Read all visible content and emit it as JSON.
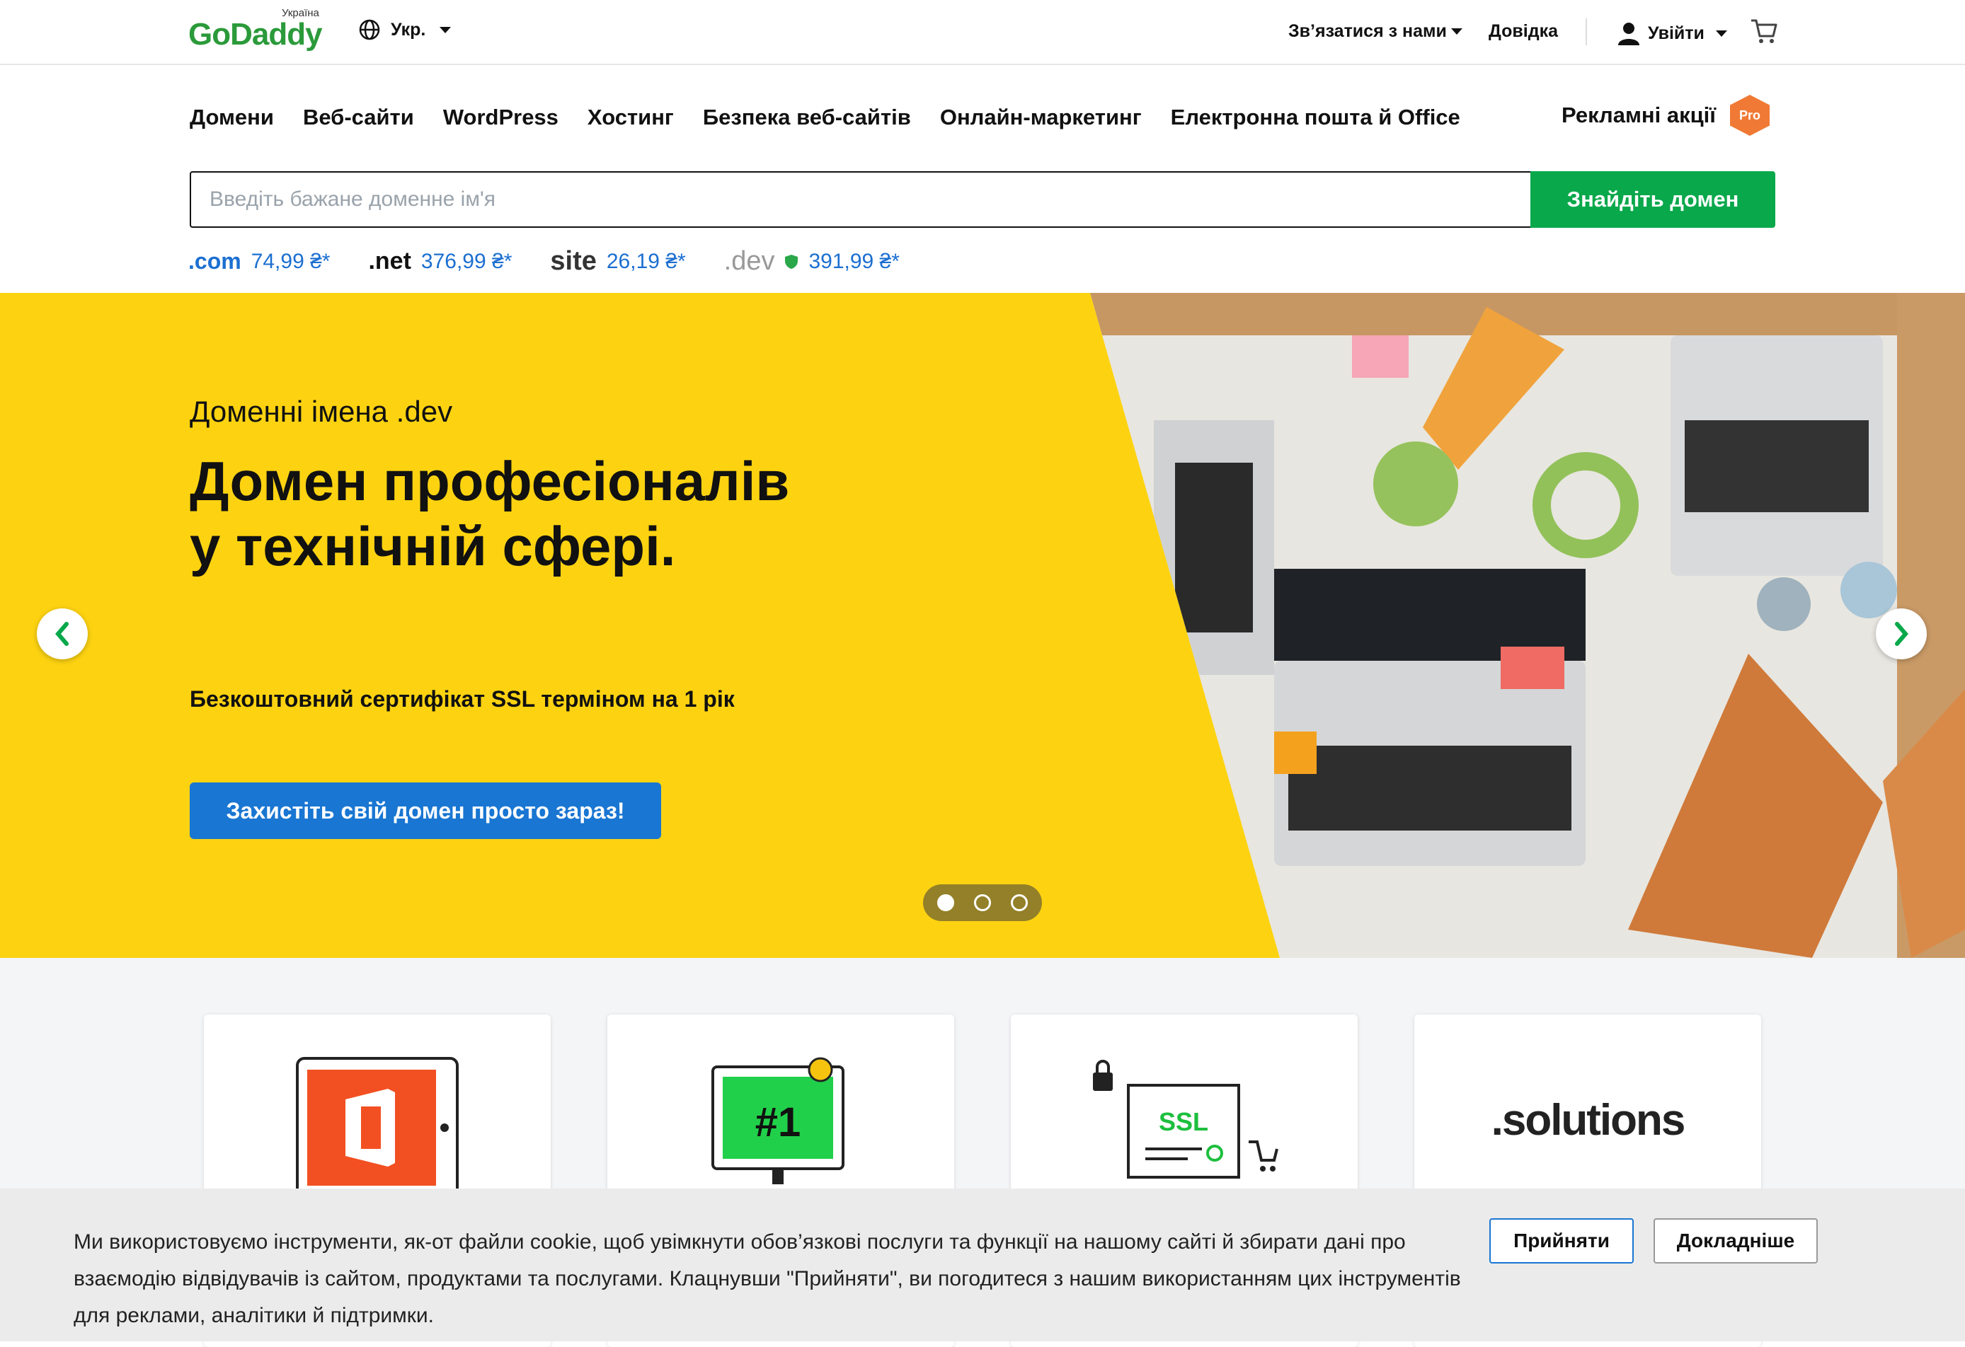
{
  "brand": {
    "name": "GoDaddy",
    "region": "Україна"
  },
  "topbar": {
    "language": "Укр.",
    "contact": "Зв’язатися з нами",
    "help": "Довідка",
    "login": "Увійти"
  },
  "nav": {
    "items": [
      "Домени",
      "Веб-сайти",
      "WordPress",
      "Хостинг",
      "Безпека веб-сайтів",
      "Онлайн-маркетинг",
      "Електронна пошта й Office"
    ],
    "promo": "Рекламні акції",
    "pro_badge": "Pro"
  },
  "search": {
    "placeholder": "Введіть бажане доменне ім'я",
    "button": "Знайдіть домен"
  },
  "tlds": [
    {
      "name": ".com",
      "price": "74,99 ₴*"
    },
    {
      "name": ".net",
      "price": "376,99 ₴*"
    },
    {
      "name": "site",
      "price": "26,19 ₴*"
    },
    {
      "name": ".dev",
      "price": "391,99 ₴*"
    }
  ],
  "hero": {
    "eyebrow": "Доменні імена .dev",
    "title": "Домен професіоналів у технічній сфері.",
    "subtitle": "Безкоштовний сертифікат SSL терміном на 1 рік",
    "cta": "Захистіть свій домен просто зараз!",
    "slides": 3,
    "active_slide": 1
  },
  "cards": [
    {
      "icon": "office-tablet-icon"
    },
    {
      "icon": "number-one-monitor-icon",
      "label": "#1"
    },
    {
      "icon": "ssl-certificate-icon",
      "label": "SSL"
    },
    {
      "icon": "solutions-domain-icon",
      "label": ".solutions"
    }
  ],
  "cookie": {
    "text": "Ми використовуємо інструменти, як-от файли cookie, щоб увімкнути обов’язкові послуги та функції на нашому сайті й збирати дані про взаємодію відвідувачів із сайтом, продуктами та послугами. Клацнувши \"Прийняти\", ви погодитеся з нашим використанням цих інструментів для реклами, аналітики й підтримки.",
    "accept": "Прийняти",
    "more": "Докладніше"
  },
  "colors": {
    "brand_green": "#09a84b",
    "hero_yellow": "#fdd311",
    "cta_blue": "#1976d2",
    "price_blue": "#1c6fd1",
    "promo_orange": "#f07a35"
  }
}
